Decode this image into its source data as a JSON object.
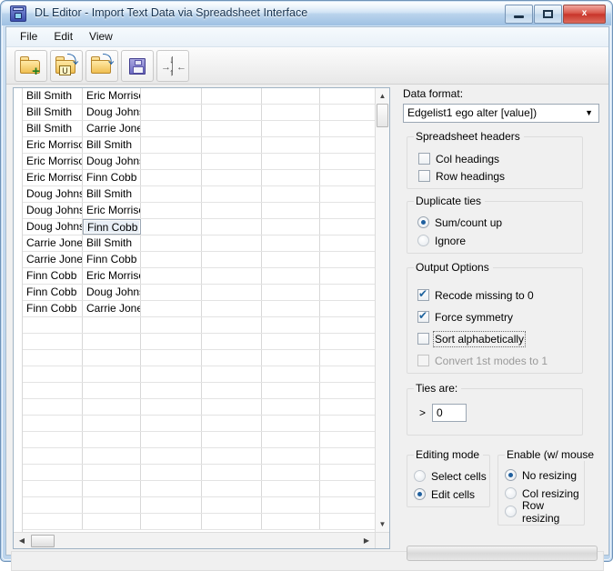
{
  "window": {
    "title": "DL Editor - Import Text Data via Spreadsheet Interface",
    "app_icon": "dl-editor-icon",
    "controls": {
      "minimize": "minimize-button",
      "maximize": "maximize-button",
      "close_label": "x"
    },
    "accent": "#b9d3ec",
    "close_color": "#c8342a"
  },
  "menu": {
    "items": [
      {
        "label": "File"
      },
      {
        "label": "Edit"
      },
      {
        "label": "View"
      }
    ]
  },
  "toolbar": {
    "buttons": [
      {
        "name": "new-file-button",
        "icon": "folder-add-icon",
        "badge": "+"
      },
      {
        "name": "open-ucinet-dataset-button",
        "icon": "folder-u-icon",
        "badge": "U"
      },
      {
        "name": "open-file-button",
        "icon": "folder-open-icon",
        "badge": ""
      },
      {
        "name": "save-file-button",
        "icon": "floppy-save-icon",
        "badge": ""
      },
      {
        "name": "fit-columns-button",
        "icon": "collapse-arrows-icon",
        "badge": ""
      }
    ]
  },
  "spreadsheet": {
    "columns": 6,
    "visible_rows": 27,
    "selected_cell": {
      "row": 8,
      "col": 1,
      "value": "Finn Cobb"
    },
    "rows": [
      [
        "Bill Smith",
        "Eric Morrison",
        "",
        "",
        "",
        ""
      ],
      [
        "Bill Smith",
        "Doug Johnson",
        "",
        "",
        "",
        ""
      ],
      [
        "Bill Smith",
        "Carrie Jones",
        "",
        "",
        "",
        ""
      ],
      [
        "Eric Morrison",
        "Bill Smith",
        "",
        "",
        "",
        ""
      ],
      [
        "Eric Morrison",
        "Doug Johnson",
        "",
        "",
        "",
        ""
      ],
      [
        "Eric Morrison",
        "Finn Cobb",
        "",
        "",
        "",
        ""
      ],
      [
        "Doug Johnson",
        "Bill Smith",
        "",
        "",
        "",
        ""
      ],
      [
        "Doug Johnson",
        "Eric Morrison",
        "",
        "",
        "",
        ""
      ],
      [
        "Doug Johnson",
        "Finn Cobb",
        "",
        "",
        "",
        ""
      ],
      [
        "Carrie Jones",
        "Bill Smith",
        "",
        "",
        "",
        ""
      ],
      [
        "Carrie Jones",
        "Finn Cobb",
        "",
        "",
        "",
        ""
      ],
      [
        "Finn Cobb",
        "Eric Morrison",
        "",
        "",
        "",
        ""
      ],
      [
        "Finn Cobb",
        "Doug Johnson",
        "",
        "",
        "",
        ""
      ],
      [
        "Finn Cobb",
        "Carrie Jones",
        "",
        "",
        "",
        ""
      ],
      [
        "",
        "",
        "",
        "",
        "",
        ""
      ],
      [
        "",
        "",
        "",
        "",
        "",
        ""
      ],
      [
        "",
        "",
        "",
        "",
        "",
        ""
      ],
      [
        "",
        "",
        "",
        "",
        "",
        ""
      ],
      [
        "",
        "",
        "",
        "",
        "",
        ""
      ],
      [
        "",
        "",
        "",
        "",
        "",
        ""
      ],
      [
        "",
        "",
        "",
        "",
        "",
        ""
      ],
      [
        "",
        "",
        "",
        "",
        "",
        ""
      ],
      [
        "",
        "",
        "",
        "",
        "",
        ""
      ],
      [
        "",
        "",
        "",
        "",
        "",
        ""
      ],
      [
        "",
        "",
        "",
        "",
        "",
        ""
      ],
      [
        "",
        "",
        "",
        "",
        "",
        ""
      ],
      [
        "",
        "",
        "",
        "",
        "",
        ""
      ]
    ],
    "vscroll": {
      "up": "▲",
      "down": "▼"
    },
    "hscroll": {
      "left": "◀",
      "right": "▶"
    }
  },
  "panel": {
    "data_format": {
      "label": "Data format:",
      "value": "Edgelist1 ego alter [value])"
    },
    "spreadsheet_headers": {
      "title": "Spreadsheet headers",
      "options": [
        {
          "label": "Col headings",
          "checked": false
        },
        {
          "label": "Row headings",
          "checked": false
        }
      ]
    },
    "duplicate_ties": {
      "title": "Duplicate ties",
      "options": [
        {
          "label": "Sum/count up",
          "selected": true
        },
        {
          "label": "Ignore",
          "selected": false
        }
      ]
    },
    "output_options": {
      "title": "Output Options",
      "options": [
        {
          "label": "Recode missing to 0",
          "checked": true,
          "disabled": false,
          "focused": false
        },
        {
          "label": "Force symmetry",
          "checked": true,
          "disabled": false,
          "focused": false
        },
        {
          "label": "Sort alphabetically",
          "checked": false,
          "disabled": false,
          "focused": true
        },
        {
          "label": "Convert 1st modes to 1",
          "checked": false,
          "disabled": true,
          "focused": false
        }
      ]
    },
    "ties_are": {
      "title": "Ties are:",
      "operator": ">",
      "value": "0"
    },
    "editing_mode": {
      "title": "Editing mode",
      "options": [
        {
          "label": "Select cells",
          "selected": false
        },
        {
          "label": "Edit cells",
          "selected": true
        }
      ]
    },
    "enable_mouse": {
      "title": "Enable (w/ mouse",
      "options": [
        {
          "label": "No resizing",
          "selected": true
        },
        {
          "label": "Col resizing",
          "selected": false
        },
        {
          "label": "Row resizing",
          "selected": false
        }
      ]
    },
    "progress": {
      "name": "progress-bar",
      "value": 0
    }
  }
}
